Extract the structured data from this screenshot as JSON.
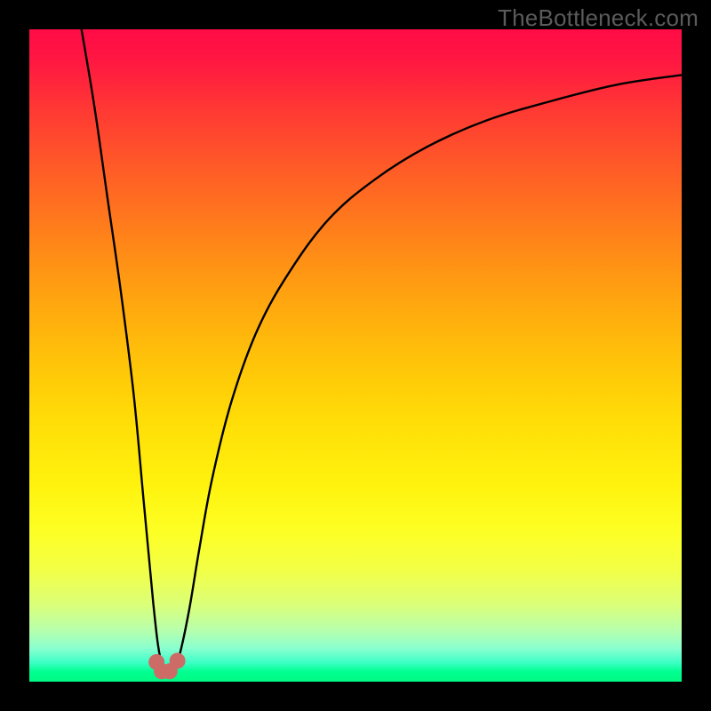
{
  "watermark": "TheBottleneck.com",
  "colors": {
    "frame": "#000000",
    "curve": "#000000",
    "marker_fill": "#cd6b67",
    "marker_stroke": "#cd6b67"
  },
  "chart_data": {
    "type": "line",
    "title": "",
    "xlabel": "",
    "ylabel": "",
    "xlim": [
      0,
      100
    ],
    "ylim": [
      0,
      100
    ],
    "grid": false,
    "legend": false,
    "notes": "Background is a vertical gradient from red (top, high bottleneck) through orange/yellow to green (bottom, low bottleneck). No axis ticks or numeric labels are shown; x/y values are approximate positions within the plotting area (0–100).",
    "series": [
      {
        "name": "bottleneck-curve",
        "x": [
          8,
          10,
          12,
          14,
          16,
          17.5,
          19,
          20,
          21,
          22,
          23,
          24.5,
          26,
          28,
          31,
          35,
          40,
          46,
          53,
          61,
          70,
          80,
          90,
          100
        ],
        "y": [
          100,
          88,
          74,
          60,
          44,
          28,
          12,
          4,
          1.5,
          2,
          4,
          11,
          20,
          31,
          43,
          54,
          63,
          71,
          77,
          82,
          86,
          89,
          91.5,
          93
        ]
      }
    ],
    "markers": [
      {
        "x": 19.5,
        "y": 3.0
      },
      {
        "x": 20.3,
        "y": 1.6
      },
      {
        "x": 21.5,
        "y": 1.6
      },
      {
        "x": 22.7,
        "y": 3.2
      }
    ]
  }
}
